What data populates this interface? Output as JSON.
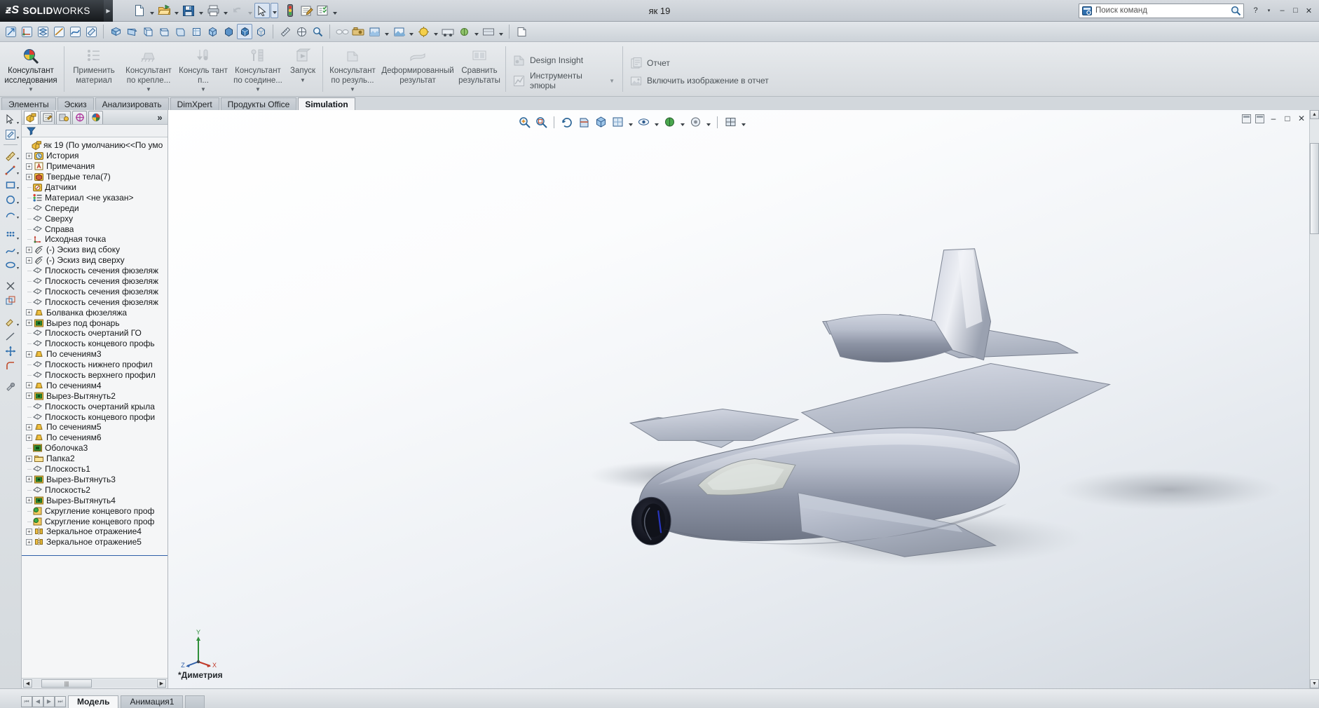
{
  "app": {
    "brand_ds": "ƶS",
    "brand_name_bold": "SOLID",
    "brand_name_light": "WORKS",
    "document_title": "як 19"
  },
  "quick_access": {
    "items": [
      {
        "name": "new-document",
        "icon": "new-doc-icon",
        "has_dropdown": true
      },
      {
        "name": "open-document",
        "icon": "open-folder-icon",
        "has_dropdown": true
      },
      {
        "name": "save-document",
        "icon": "save-disk-icon",
        "has_dropdown": true
      },
      {
        "name": "print-document",
        "icon": "printer-icon",
        "has_dropdown": true
      },
      {
        "name": "undo",
        "icon": "undo-arrow-icon",
        "has_dropdown": true
      },
      {
        "name": "select",
        "icon": "cursor-arrow-icon",
        "has_dropdown": true
      },
      {
        "name": "rebuild",
        "icon": "traffic-light-icon",
        "has_dropdown": false
      },
      {
        "name": "file-properties",
        "icon": "properties-icon",
        "has_dropdown": false
      },
      {
        "name": "options",
        "icon": "options-list-icon",
        "has_dropdown": true
      }
    ]
  },
  "search": {
    "placeholder": "Поиск команд",
    "icon": "magnifier-icon",
    "prefix_icon": "command-search-icon"
  },
  "window_controls": {
    "help": "?",
    "help_caret": "▾",
    "minimize": "–",
    "maximize": "□",
    "close": "✕"
  },
  "ribbon": {
    "groups": [
      {
        "name": "study",
        "buttons": [
          {
            "label": "Консультант исследования",
            "icon": "study-advisor-icon",
            "caret": true,
            "enabled": true,
            "name": "study-advisor"
          }
        ]
      },
      {
        "name": "setup",
        "buttons": [
          {
            "label": "Применить материал",
            "icon": "apply-material-icon",
            "caret": false,
            "enabled": false,
            "name": "apply-material"
          },
          {
            "label": "Консультант по крепле...",
            "icon": "fixture-advisor-icon",
            "caret": true,
            "enabled": false,
            "name": "fixture-advisor"
          },
          {
            "label": "Консуль тант п...",
            "icon": "load-advisor-icon",
            "caret": true,
            "enabled": false,
            "name": "load-advisor"
          },
          {
            "label": "Консультант по соедине...",
            "icon": "connection-advisor-icon",
            "caret": true,
            "enabled": false,
            "name": "connection-advisor"
          },
          {
            "label": "Запуск",
            "icon": "run-icon",
            "caret": true,
            "enabled": false,
            "name": "run-study"
          }
        ]
      },
      {
        "name": "results",
        "buttons": [
          {
            "label": "Консультант по резуль...",
            "icon": "results-advisor-icon",
            "caret": true,
            "enabled": false,
            "name": "results-advisor"
          },
          {
            "label": "Деформированный результат",
            "icon": "deformed-result-icon",
            "caret": false,
            "enabled": false,
            "name": "deformed-result"
          },
          {
            "label": "Сравнить результаты",
            "icon": "compare-results-icon",
            "caret": false,
            "enabled": false,
            "name": "compare-results"
          }
        ]
      },
      {
        "name": "design-insight",
        "items": [
          {
            "label": "Design Insight",
            "icon": "design-insight-icon",
            "caret": false,
            "name": "design-insight"
          },
          {
            "label": "Инструменты эпюры",
            "icon": "plot-tools-icon",
            "caret": true,
            "name": "plot-tools"
          }
        ]
      },
      {
        "name": "report",
        "items": [
          {
            "label": "Отчет",
            "icon": "report-icon",
            "caret": false,
            "name": "report"
          },
          {
            "label": "Включить изображение в отчет",
            "icon": "include-image-icon",
            "caret": false,
            "name": "include-image-in-report"
          }
        ]
      }
    ]
  },
  "command_tabs": [
    {
      "label": "Элементы",
      "selected": false,
      "name": "tab-features"
    },
    {
      "label": "Эскиз",
      "selected": false,
      "name": "tab-sketch"
    },
    {
      "label": "Анализировать",
      "selected": false,
      "name": "tab-evaluate"
    },
    {
      "label": "DimXpert",
      "selected": false,
      "name": "tab-dimxpert"
    },
    {
      "label": "Продукты Office",
      "selected": false,
      "name": "tab-office-products"
    },
    {
      "label": "Simulation",
      "selected": true,
      "name": "tab-simulation"
    }
  ],
  "tree_panel": {
    "tabs": [
      {
        "name": "feature-manager-tab",
        "icon": "feature-tree-icon",
        "selected": true
      },
      {
        "name": "property-manager-tab",
        "icon": "property-manager-icon",
        "selected": false
      },
      {
        "name": "configuration-manager-tab",
        "icon": "configuration-manager-icon",
        "selected": false
      },
      {
        "name": "dimxpert-manager-tab",
        "icon": "dimxpert-target-icon",
        "selected": false
      },
      {
        "name": "display-manager-tab",
        "icon": "display-palette-icon",
        "selected": false
      }
    ],
    "more_label": "»",
    "filter_icon": "filter-funnel-icon",
    "root": {
      "label": "як 19  (По умолчанию<<По умо",
      "icon": "part-icon"
    },
    "items": [
      {
        "label": "История",
        "icon": "history-clock-icon",
        "expandable": true
      },
      {
        "label": "Примечания",
        "icon": "annotations-a-icon",
        "expandable": true
      },
      {
        "label": "Твердые тела(7)",
        "icon": "solid-bodies-icon",
        "expandable": true
      },
      {
        "label": "Датчики",
        "icon": "sensors-icon",
        "expandable": false
      },
      {
        "label": "Материал <не указан>",
        "icon": "material-icon",
        "expandable": false
      },
      {
        "label": "Спереди",
        "icon": "plane-icon",
        "expandable": false
      },
      {
        "label": "Сверху",
        "icon": "plane-icon",
        "expandable": false
      },
      {
        "label": "Справа",
        "icon": "plane-icon",
        "expandable": false
      },
      {
        "label": "Исходная точка",
        "icon": "origin-icon",
        "expandable": false
      },
      {
        "label": "(-) Эскиз вид сбоку",
        "icon": "sketch-icon",
        "expandable": true
      },
      {
        "label": "(-) Эскиз вид сверху",
        "icon": "sketch-icon",
        "expandable": true
      },
      {
        "label": "Плоскость сечения фюзеляж",
        "icon": "plane-icon",
        "expandable": false
      },
      {
        "label": "Плоскость сечения фюзеляж",
        "icon": "plane-icon",
        "expandable": false
      },
      {
        "label": "Плоскость сечения фюзеляж",
        "icon": "plane-icon",
        "expandable": false
      },
      {
        "label": "Плоскость сечения фюзеляж",
        "icon": "plane-icon",
        "expandable": false
      },
      {
        "label": "Болванка фюзеляжа",
        "icon": "loft-icon",
        "expandable": true
      },
      {
        "label": "Вырез под фонарь",
        "icon": "cut-extrude-icon",
        "expandable": true
      },
      {
        "label": "Плоскость очертаний ГО",
        "icon": "plane-icon",
        "expandable": false
      },
      {
        "label": "Плоскость концевого профь",
        "icon": "plane-icon",
        "expandable": false
      },
      {
        "label": "По сечениям3",
        "icon": "loft-icon",
        "expandable": true
      },
      {
        "label": "Плоскость нижнего профил",
        "icon": "plane-icon",
        "expandable": false
      },
      {
        "label": "Плоскость верхнего профил",
        "icon": "plane-icon",
        "expandable": false
      },
      {
        "label": "По сечениям4",
        "icon": "loft-icon",
        "expandable": true
      },
      {
        "label": "Вырез-Вытянуть2",
        "icon": "cut-extrude-icon",
        "expandable": true
      },
      {
        "label": "Плоскость очертаний крыла",
        "icon": "plane-icon",
        "expandable": false
      },
      {
        "label": "Плоскость концевого профи",
        "icon": "plane-icon",
        "expandable": false
      },
      {
        "label": "По сечениям5",
        "icon": "loft-icon",
        "expandable": true
      },
      {
        "label": "По сечениям6",
        "icon": "loft-icon",
        "expandable": true
      },
      {
        "label": "Оболочка3",
        "icon": "shell-icon",
        "expandable": false
      },
      {
        "label": "Папка2",
        "icon": "folder-icon",
        "expandable": true
      },
      {
        "label": "Плоскость1",
        "icon": "plane-icon",
        "expandable": false
      },
      {
        "label": "Вырез-Вытянуть3",
        "icon": "cut-extrude-icon",
        "expandable": true
      },
      {
        "label": "Плоскость2",
        "icon": "plane-icon",
        "expandable": false
      },
      {
        "label": "Вырез-Вытянуть4",
        "icon": "cut-extrude-icon",
        "expandable": true
      },
      {
        "label": "Скругление концевого проф",
        "icon": "fillet-icon",
        "expandable": false
      },
      {
        "label": "Скругление концевого проф",
        "icon": "fillet-icon",
        "expandable": false
      },
      {
        "label": "Зеркальное отражение4",
        "icon": "mirror-icon",
        "expandable": true
      },
      {
        "label": "Зеркальное отражение5",
        "icon": "mirror-icon",
        "expandable": true
      }
    ],
    "hscroll": {
      "left_arrow": "◀",
      "right_arrow": "▶",
      "thumb_grip": "|||"
    }
  },
  "view_toolbar": {
    "items": [
      {
        "name": "zoom-to-fit-icon",
        "dropdown": false
      },
      {
        "name": "zoom-to-area-icon",
        "dropdown": false
      },
      {
        "name": "rotate-view-icon",
        "dropdown": false
      },
      {
        "name": "section-view-icon",
        "dropdown": false
      },
      {
        "name": "view-orientation-icon",
        "dropdown": true
      },
      {
        "name": "display-style-icon",
        "dropdown": true
      },
      {
        "name": "hide-show-items-icon",
        "dropdown": true
      },
      {
        "name": "apply-scene-icon",
        "dropdown": true
      },
      {
        "name": "view-settings-icon",
        "dropdown": true
      },
      {
        "name": "viewport-icon",
        "dropdown": true
      }
    ]
  },
  "graphics": {
    "view_orientation_label": "*Диметрия",
    "triad": {
      "x": "X",
      "y": "Y",
      "z": "Z"
    },
    "corner_buttons": [
      "restore-view-icon",
      "maximize-view-icon",
      "minimize-window",
      "restore-window",
      "close-window"
    ],
    "model_name": "як 19"
  },
  "bottom_tabs": {
    "nav": [
      "⏮",
      "◀",
      "▶",
      "⏭"
    ],
    "tabs": [
      {
        "label": "Модель",
        "selected": true,
        "name": "bottom-tab-model"
      },
      {
        "label": "Анимация1",
        "selected": false,
        "name": "bottom-tab-animation1"
      }
    ]
  },
  "colors": {
    "accent": "#2f5fa8",
    "ribbon_bg": "#dfe3e7",
    "tree_bg": "#f5f6f7",
    "plane_icon": "#5a6168",
    "title_dark": "#15181b"
  }
}
